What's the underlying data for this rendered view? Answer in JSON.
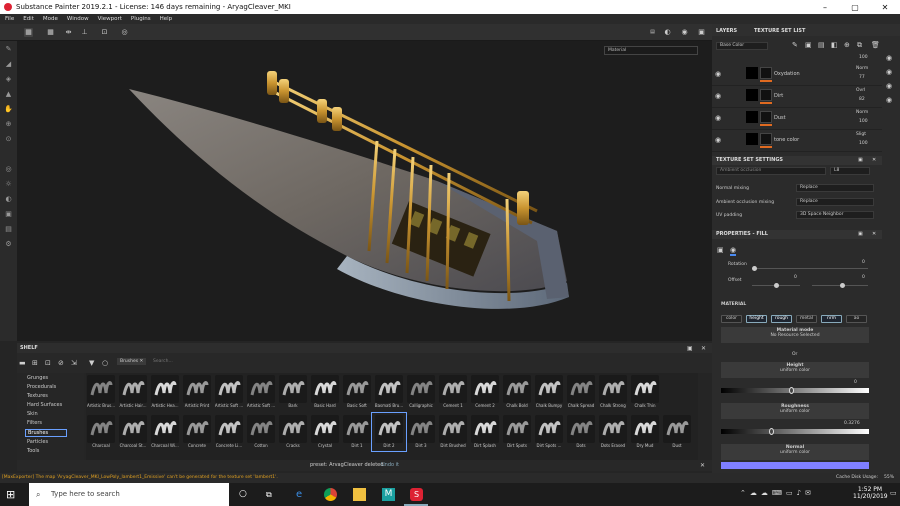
{
  "window": {
    "title": "Substance Painter 2019.2.1 - License: 146 days remaining - AryagCleaver_MKI"
  },
  "menu": [
    "File",
    "Edit",
    "Mode",
    "Window",
    "Viewport",
    "Plugins",
    "Help"
  ],
  "viewport": {
    "material_select": "Material"
  },
  "layers_panel": {
    "tabs": [
      "LAYERS",
      "TEXTURE SET LIST"
    ],
    "channel": "Base Color",
    "layers": [
      {
        "name": "Oxydation",
        "blend": "Norm",
        "opacity": "77"
      },
      {
        "name": "Dirt",
        "blend": "Ovrl",
        "opacity": "82"
      },
      {
        "name": "Dust",
        "blend": "Norm",
        "opacity": "100"
      },
      {
        "name": "tone color",
        "blend": "Sligt",
        "opacity": "100"
      }
    ],
    "top_opacity": "100"
  },
  "texture_set_settings": {
    "title": "TEXTURE SET SETTINGS",
    "ambient_occlusion": "Ambient occlusion",
    "ao_value": "L8",
    "rows": [
      {
        "label": "Normal mixing",
        "value": "Replace"
      },
      {
        "label": "Ambient occlusion mixing",
        "value": "Replace"
      },
      {
        "label": "UV padding",
        "value": "3D Space Neighbor"
      }
    ]
  },
  "properties": {
    "title": "PROPERTIES - FILL",
    "rotation_label": "Rotation",
    "rotation_value": "0",
    "offset_label": "Offset",
    "offset_x": "0",
    "offset_y": "0",
    "material_label": "MATERIAL",
    "channels": [
      "color",
      "height",
      "rough",
      "metal",
      "nrm",
      "ao"
    ],
    "channels_on": [
      false,
      true,
      true,
      false,
      true,
      false
    ],
    "material_mode": "Material mode",
    "no_resource": "No Resource Selected",
    "or": "Or",
    "height": {
      "label": "Height",
      "sub": "uniform color",
      "value": "0",
      "level": 0.46
    },
    "roughness": {
      "label": "Roughness",
      "sub": "uniform color",
      "value": "0.3276",
      "level": 0.3276
    },
    "normal": {
      "label": "Normal",
      "sub": "uniform color"
    },
    "normal_color": "#7f7fff"
  },
  "shelf": {
    "title": "SHELF",
    "filter": "Brushes",
    "search_placeholder": "Search...",
    "categories": [
      "Grunges",
      "Procedurals",
      "Textures",
      "Hard Surfaces",
      "Skin",
      "Filters",
      "Brushes",
      "Particles",
      "Tools"
    ],
    "selected_category": "Brushes",
    "brushes_row1": [
      "Artistic Brus...",
      "Artistic Hair...",
      "Artistic Hea...",
      "Artistic Print",
      "Artistic Soft ...",
      "Artistic Soft ...",
      "Bark",
      "Basic Hard",
      "Basic Soft",
      "Basmati Bru...",
      "Calligraphic",
      "Cement 1",
      "Cement 2",
      "Chalk Bold",
      "Chalk Bumpy",
      "Chalk Spread",
      "Chalk Strong",
      "Chalk Thin"
    ],
    "brushes_row2": [
      "Charcoal",
      "Charcoal St...",
      "Charcoal Wi...",
      "Concrete",
      "Concrete Li...",
      "Cotton",
      "Cracks",
      "Crystal",
      "Dirt 1",
      "Dirt 2",
      "Dirt 3",
      "Dirt Brushed",
      "Dirt Splash",
      "Dirt Spots",
      "Dirt Spots ...",
      "Dots",
      "Dots Erased",
      "Dry Mud",
      "Dust"
    ],
    "status": "preset: ArvagCleaver deleted.",
    "undo": "Undo it"
  },
  "log": {
    "message": "[MaxExporter] The map 'AryagCleaver_MKI_LowPoly_lambert1_Emissive' can't be generated for the texture set 'lambert1'.",
    "cache": "Cache Disk Usage:",
    "cache_value": "55%"
  },
  "taskbar": {
    "search_placeholder": "Type here to search",
    "time": "1:52 PM",
    "date": "11/20/2019"
  }
}
